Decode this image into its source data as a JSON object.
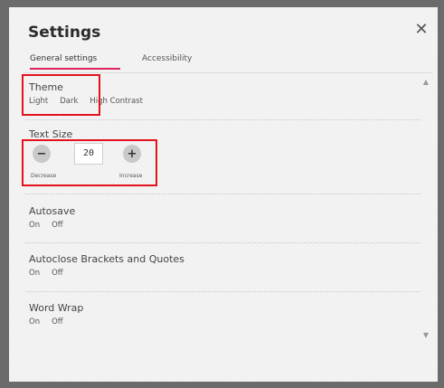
{
  "dialog": {
    "title": "Settings",
    "close_icon": "close-icon"
  },
  "tabs": [
    {
      "label": "General settings",
      "active": true
    },
    {
      "label": "Accessibility",
      "active": false
    }
  ],
  "theme": {
    "title": "Theme",
    "options": [
      "Light",
      "Dark",
      "High Contrast"
    ]
  },
  "text_size": {
    "title": "Text Size",
    "value": "20",
    "decrease_label": "Decrease",
    "increase_label": "Increase"
  },
  "autosave": {
    "title": "Autosave",
    "options": [
      "On",
      "Off"
    ]
  },
  "autoclose": {
    "title": "Autoclose Brackets and Quotes",
    "options": [
      "On",
      "Off"
    ]
  },
  "word_wrap": {
    "title": "Word Wrap",
    "options": [
      "On",
      "Off"
    ]
  },
  "colors": {
    "accent": "#e0245e",
    "highlight": "#e3121d"
  }
}
